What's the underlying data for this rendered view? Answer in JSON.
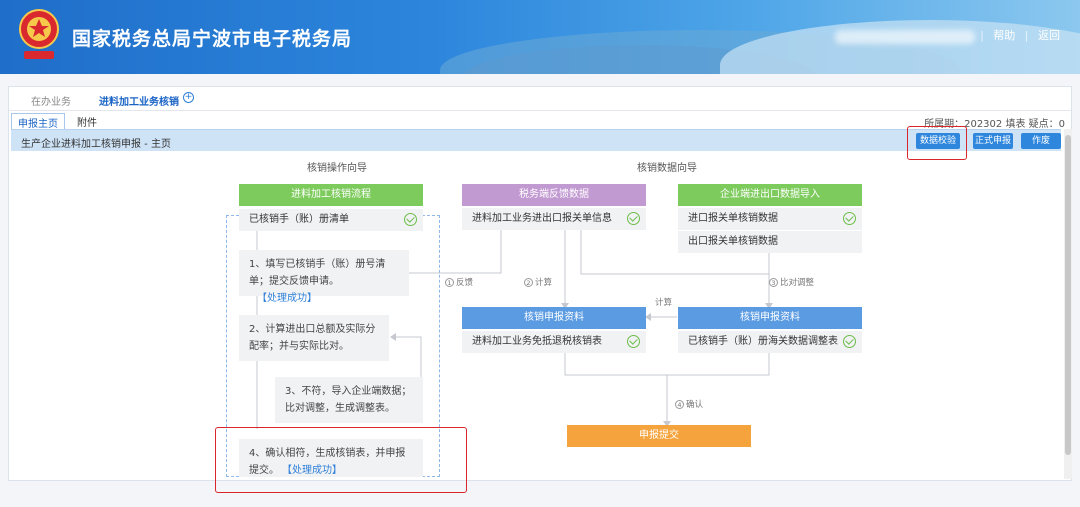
{
  "header": {
    "title": "国家税务总局宁波市电子税务局",
    "links": {
      "help": "帮助",
      "back": "返回",
      "separator": "|"
    }
  },
  "biz_tabs": {
    "in_progress": "在办业务",
    "current": "进料加工业务核销",
    "add": "+"
  },
  "sub_tabs": {
    "main": "申报主页",
    "attachment": "附件"
  },
  "period_info": "所属期：202302   填表   疑点：0",
  "titlebar": {
    "text": "生产企业进料加工核销申报 - 主页",
    "buttons": {
      "validate": "数据校验",
      "submit": "正式申报",
      "void": "作废"
    }
  },
  "guides": {
    "operation": "核销操作向导",
    "data": "核销数据向导"
  },
  "flow": {
    "header": "进料加工核销流程",
    "list_row": "已核销手（账）册清单",
    "steps": [
      {
        "text": "1、填写已核销手（账）册号清单；提交反馈申请。",
        "status": "【处理成功】"
      },
      {
        "text": "2、计算进出口总额及实际分配率；并与实际比对。",
        "status": ""
      },
      {
        "text": "3、不符，导入企业端数据；比对调整，生成调整表。",
        "status": ""
      },
      {
        "text": "4、确认相符，生成核销表，并申报提交。",
        "status": "【处理成功】"
      }
    ]
  },
  "data_flow": {
    "tax_feedback": {
      "header": "税务端反馈数据",
      "row": "进料加工业务进出口报关单信息"
    },
    "enterprise_import": {
      "header": "企业端进出口数据导入",
      "rows": [
        "进口报关单核销数据",
        "出口报关单核销数据"
      ]
    },
    "verify_left": {
      "header": "核销申报资料",
      "row": "进料加工业务免抵退税核销表"
    },
    "verify_right": {
      "header": "核销申报资料",
      "row": "已核销手（账）册海关数据调整表"
    },
    "submit": "申报提交",
    "arrows": {
      "feedback": "反馈",
      "calc1": "计算",
      "compare": "比对调整",
      "calc2": "计算",
      "confirm": "确认"
    },
    "arrow_nums": {
      "feedback": "1",
      "calc1": "2",
      "compare": "3",
      "confirm": "4"
    }
  },
  "colors": {
    "green": "#7ecb5d",
    "purple": "#c29ad2",
    "blue": "#5a9be2",
    "orange": "#f5a43d",
    "highlight": "#d8262b"
  }
}
